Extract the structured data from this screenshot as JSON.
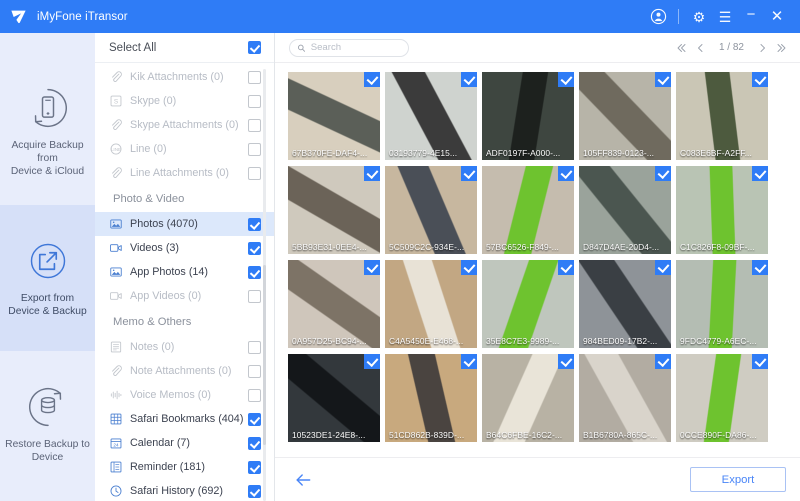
{
  "titlebar": {
    "app_name": "iMyFone iTransor",
    "logo_icon": "itransor-logo-icon",
    "buttons": [
      {
        "name": "account-icon",
        "glyph": "●"
      },
      {
        "name": "gear-icon",
        "glyph": "⚙"
      },
      {
        "name": "menu-icon",
        "glyph": "☰"
      },
      {
        "name": "minimize-icon",
        "glyph": "−"
      },
      {
        "name": "close-icon",
        "glyph": "✕"
      }
    ]
  },
  "rail": {
    "items": [
      {
        "icon": "acquire-backup-icon",
        "line1": "Acquire Backup from",
        "line2": "Device & iCloud",
        "active": false
      },
      {
        "icon": "export-icon",
        "line1": "Export from",
        "line2": "Device & Backup",
        "active": true
      },
      {
        "icon": "restore-backup-icon",
        "line1": "Restore Backup to",
        "line2": "Device",
        "active": false
      }
    ]
  },
  "sidebar": {
    "select_all_label": "Select All",
    "select_all_checked": true,
    "rows": [
      {
        "type": "item",
        "icon": "paperclip-icon",
        "label": "Kik Attachments (0)",
        "checked": false,
        "disabled": true,
        "selected": false
      },
      {
        "type": "item",
        "icon": "skype-icon",
        "label": "Skype (0)",
        "checked": false,
        "disabled": true,
        "selected": false
      },
      {
        "type": "item",
        "icon": "paperclip-icon",
        "label": "Skype Attachments (0)",
        "checked": false,
        "disabled": true,
        "selected": false
      },
      {
        "type": "item",
        "icon": "line-icon",
        "label": "Line (0)",
        "checked": false,
        "disabled": true,
        "selected": false
      },
      {
        "type": "item",
        "icon": "paperclip-icon",
        "label": "Line Attachments (0)",
        "checked": false,
        "disabled": true,
        "selected": false
      },
      {
        "type": "header",
        "label": "Photo & Video"
      },
      {
        "type": "item",
        "icon": "photo-icon",
        "label": "Photos (4070)",
        "checked": true,
        "disabled": false,
        "selected": true
      },
      {
        "type": "item",
        "icon": "video-icon",
        "label": "Videos (3)",
        "checked": true,
        "disabled": false,
        "selected": false
      },
      {
        "type": "item",
        "icon": "photo-icon",
        "label": "App Photos (14)",
        "checked": true,
        "disabled": false,
        "selected": false
      },
      {
        "type": "item",
        "icon": "video-icon",
        "label": "App Videos (0)",
        "checked": false,
        "disabled": true,
        "selected": false
      },
      {
        "type": "header",
        "label": "Memo & Others"
      },
      {
        "type": "item",
        "icon": "notes-icon",
        "label": "Notes (0)",
        "checked": false,
        "disabled": true,
        "selected": false
      },
      {
        "type": "item",
        "icon": "paperclip-icon",
        "label": "Note Attachments (0)",
        "checked": false,
        "disabled": true,
        "selected": false
      },
      {
        "type": "item",
        "icon": "voice-memo-icon",
        "label": "Voice Memos (0)",
        "checked": false,
        "disabled": true,
        "selected": false
      },
      {
        "type": "item",
        "icon": "bookmarks-icon",
        "label": "Safari Bookmarks (404)",
        "checked": true,
        "disabled": false,
        "selected": false
      },
      {
        "type": "item",
        "icon": "calendar-icon",
        "label": "Calendar (7)",
        "checked": true,
        "disabled": false,
        "selected": false
      },
      {
        "type": "item",
        "icon": "reminder-icon",
        "label": "Reminder (181)",
        "checked": true,
        "disabled": false,
        "selected": false
      },
      {
        "type": "item",
        "icon": "history-icon",
        "label": "Safari History (692)",
        "checked": true,
        "disabled": false,
        "selected": false
      }
    ]
  },
  "toolbar": {
    "search_icon": "search-icon",
    "search_value": "",
    "search_placeholder": "Search",
    "pager": {
      "first_icon": "chevron-double-left-icon",
      "prev_icon": "chevron-left-icon",
      "count_label": "1 / 82",
      "next_icon": "chevron-right-icon",
      "last_icon": "chevron-double-right-icon"
    }
  },
  "grid": {
    "items": [
      {
        "caption": "67B370FE-DAF4-...",
        "checked": true,
        "c1": "#d8cfbe",
        "c2": "#5b5f58",
        "c3": "#7fc24a"
      },
      {
        "caption": "03193779-4E15...",
        "checked": true,
        "c1": "#cfd3cf",
        "c2": "#3b3b3b",
        "c3": "#6ec32f"
      },
      {
        "caption": "ADF0197F-A000-...",
        "checked": true,
        "c1": "#3e4640",
        "c2": "#1d211e",
        "c3": "#7a8a74"
      },
      {
        "caption": "105FF839-0123-...",
        "checked": true,
        "c1": "#b7b4a8",
        "c2": "#6f6a5e",
        "c3": "#d6d2c4"
      },
      {
        "caption": "C083E6BF-A2FF...",
        "checked": true,
        "c1": "#cac6b5",
        "c2": "#4d5a3e",
        "c3": "#6ec32f"
      },
      {
        "caption": "5BB93E31-0EE4-...",
        "checked": true,
        "c1": "#cfc9bd",
        "c2": "#6b6358",
        "c3": "#e4ded2"
      },
      {
        "caption": "5C509C2C-934E-...",
        "checked": true,
        "c1": "#c7b79f",
        "c2": "#4a4f57",
        "c3": "#e8e4dc"
      },
      {
        "caption": "57BC6526-F849-...",
        "checked": true,
        "c1": "#c5bcae",
        "c2": "#6ec32f",
        "c3": "#8a7f6e"
      },
      {
        "caption": "D847D4AE-20D4-...",
        "checked": true,
        "c1": "#9aa39b",
        "c2": "#4b5650",
        "c3": "#c9cfc6"
      },
      {
        "caption": "C1C826F8-09BF-...",
        "checked": true,
        "c1": "#b9c4b4",
        "c2": "#6ec32f",
        "c3": "#3c4440"
      },
      {
        "caption": "0A957D25-BC94-...",
        "checked": true,
        "c1": "#cfc6bb",
        "c2": "#7d7366",
        "c3": "#eae4d9"
      },
      {
        "caption": "C4A5450E-E468-...",
        "checked": true,
        "c1": "#c2a783",
        "c2": "#e8e2d6",
        "c3": "#8d7a5d"
      },
      {
        "caption": "35E8C7E3-9989-...",
        "checked": true,
        "c1": "#bfc6bd",
        "c2": "#6ec32f",
        "c3": "#3a4040"
      },
      {
        "caption": "984BED09-17B2-...",
        "checked": true,
        "c1": "#8e9398",
        "c2": "#3a3f44",
        "c3": "#c5cacd"
      },
      {
        "caption": "9FDC4779-A6EC-...",
        "checked": true,
        "c1": "#b4bdb3",
        "c2": "#6ec32f",
        "c3": "#dfe3da"
      },
      {
        "caption": "10523DE1-24E8-...",
        "checked": true,
        "c1": "#33383c",
        "c2": "#14171a",
        "c3": "#5c6268"
      },
      {
        "caption": "51CD862B-839D-...",
        "checked": true,
        "c1": "#c8a97e",
        "c2": "#4a4440",
        "c3": "#e3d6bd"
      },
      {
        "caption": "B64C6FBE-16C2-...",
        "checked": true,
        "c1": "#b8b2a4",
        "c2": "#e9e4d8",
        "c3": "#6e675c"
      },
      {
        "caption": "B1B6780A-865C-...",
        "checked": true,
        "c1": "#b2aca2",
        "c2": "#d9d4cb",
        "c3": "#837c70"
      },
      {
        "caption": "0CCE890F-DA86-...",
        "checked": true,
        "c1": "#cfccc2",
        "c2": "#6ec32f",
        "c3": "#9c3b34"
      }
    ]
  },
  "footer": {
    "back_icon": "back-arrow-icon",
    "export_label": "Export"
  },
  "colors": {
    "brand_blue": "#2f7cf6",
    "rail_bg": "#e8edfb",
    "rail_active_bg": "#d6e0f8",
    "row_selected_bg": "#dce8fb"
  }
}
